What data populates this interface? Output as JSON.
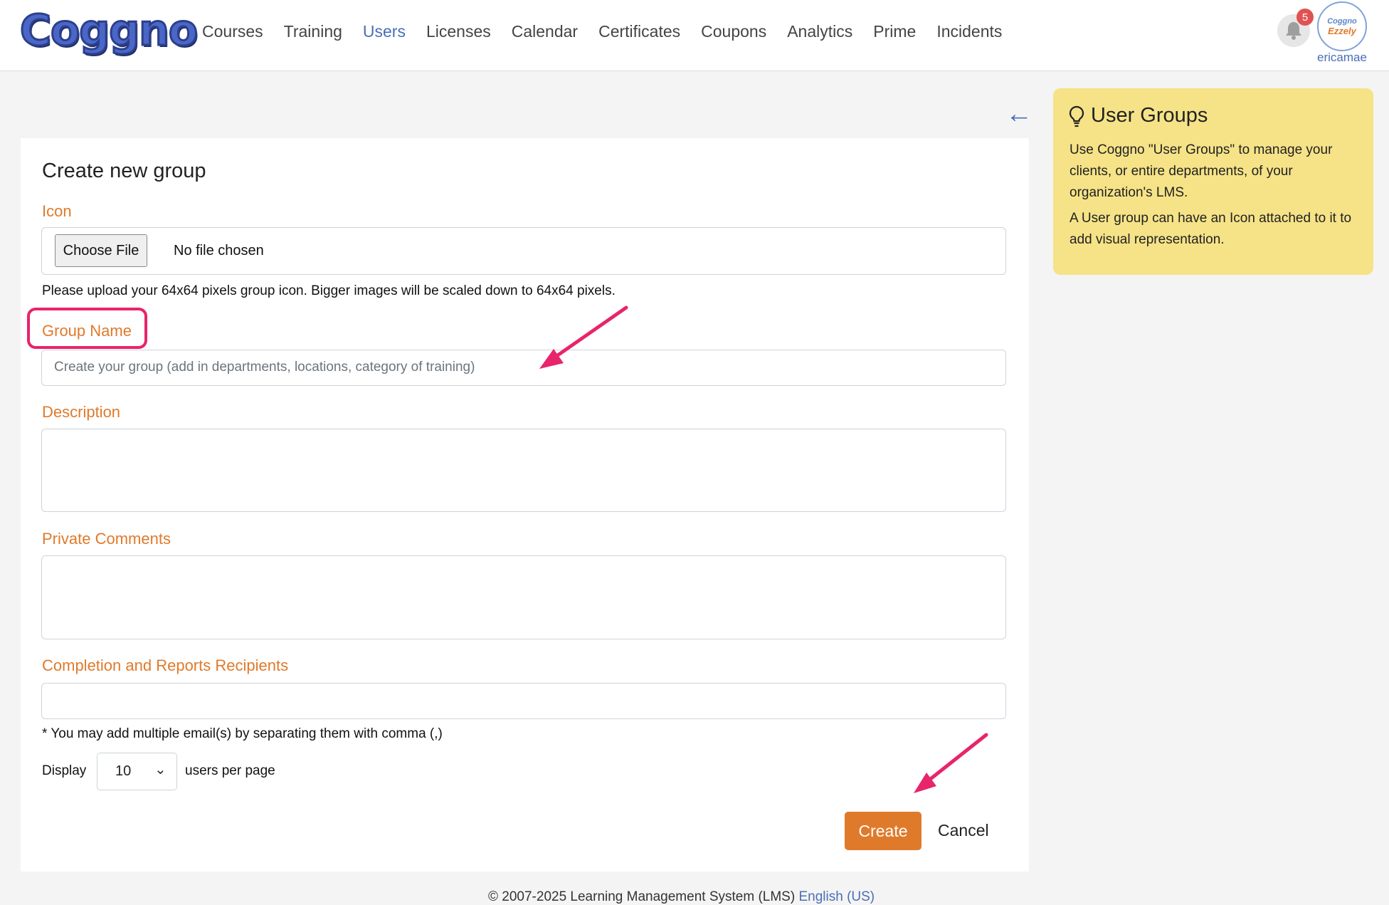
{
  "header": {
    "logo_text": "Coggno",
    "nav": [
      "Courses",
      "Training",
      "Users",
      "Licenses",
      "Calendar",
      "Certificates",
      "Coupons",
      "Analytics",
      "Prime",
      "Incidents"
    ],
    "active_nav": "Users",
    "notification_count": "5",
    "avatar_line1": "Coggno",
    "avatar_line2": "Ezzely",
    "username": "ericamae"
  },
  "form": {
    "title": "Create new group",
    "icon_label": "Icon",
    "choose_file_label": "Choose File",
    "file_status": "No file chosen",
    "icon_help": "Please upload your 64x64 pixels group icon. Bigger images will be scaled down to 64x64 pixels.",
    "group_name_label": "Group Name",
    "group_name_placeholder": "Create your group (add in departments, locations, category of training)",
    "description_label": "Description",
    "private_comments_label": "Private Comments",
    "recipients_label": "Completion and Reports Recipients",
    "recipients_help": "* You may add multiple email(s) by separating them with comma (,)",
    "display_label": "Display",
    "per_page_value": "10",
    "per_page_suffix": "users per page",
    "create_label": "Create",
    "cancel_label": "Cancel"
  },
  "tip": {
    "title": "User Groups",
    "p1": "Use Coggno \"User Groups\" to manage your clients, or entire departments, of your organization's LMS.",
    "p2": "A User group can have an Icon attached to it to add visual representation."
  },
  "footer": {
    "text": "© 2007-2025 Learning Management System (LMS)",
    "language": "English (US)"
  },
  "colors": {
    "accent_orange": "#e07a2b",
    "link_blue": "#4a6fb5",
    "annotation_pink": "#e8246b",
    "tip_yellow": "#f6e387"
  }
}
